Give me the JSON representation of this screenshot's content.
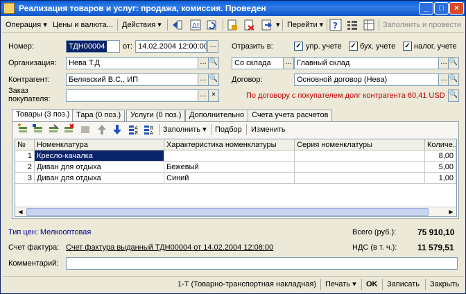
{
  "window": {
    "title": "Реализация товаров и услуг: продажа, комиссия. Проведен",
    "minimize": "_",
    "maximize": "□",
    "close": "×"
  },
  "toolbar": {
    "operation": "Операция",
    "prices": "Цены и валюта...",
    "actions": "Действия",
    "goto": "Перейти",
    "help": "?",
    "fill_and_post": "Заполнить и провести"
  },
  "form": {
    "number_label": "Номер:",
    "number_value": "ТДН00004",
    "from_label": "от:",
    "date_value": "14.02.2004 12:00:00",
    "reflect_label": "Отразить в:",
    "chk_mgmt_label": "упр. учете",
    "chk_acc_label": "бух. учете",
    "chk_tax_label": "налог. учете",
    "org_label": "Организация:",
    "org_value": "Нева Т.Д",
    "warehouse_type_value": "Со склада",
    "warehouse_value": "Главный склад",
    "contractor_label": "Контрагент:",
    "contractor_value": "Белявский В.С., ИП",
    "contract_label": "Договор:",
    "contract_value": "Основной договор (Нева)",
    "order_label_1": "Заказ",
    "order_label_2": "покупателя:",
    "order_value": "",
    "debt_text": "По договору с покупателем долг контрагента 60,41 USD"
  },
  "tabs": [
    {
      "label": "Товары (3 поз.)"
    },
    {
      "label": "Тара (0 поз.)"
    },
    {
      "label": "Услуги (0 поз.)"
    },
    {
      "label": "Дополнительно"
    },
    {
      "label": "Счета учета расчетов"
    }
  ],
  "table_toolbar": {
    "fill": "Заполнить",
    "select": "Подбор",
    "change": "Изменить"
  },
  "table": {
    "columns": [
      "№",
      "Номенклатура",
      "Характеристика номенклатуры",
      "Серия номенклатуры",
      "Количе..."
    ],
    "rows": [
      {
        "n": "1",
        "item": "Кресло-качалка",
        "char": "",
        "series": "",
        "qty": "8,00"
      },
      {
        "n": "2",
        "item": "Диван для отдыха",
        "char": "Бежевый",
        "series": "",
        "qty": "5,00"
      },
      {
        "n": "3",
        "item": "Диван для отдыха",
        "char": "Синий",
        "series": "",
        "qty": "1,00"
      }
    ]
  },
  "summary": {
    "price_type": "Тип цен: Мелкооптовая",
    "total_label": "Всего (руб.):",
    "total_value": "75 910,10",
    "vat_label": "НДС (в т. ч.):",
    "vat_value": "11 579,51",
    "invoice_label": "Счет фактура:",
    "invoice_value": "Счет фактура выданный ТДН00004 от 14.02.2004 12:08:00",
    "comment_label": "Комментарий:",
    "comment_value": ""
  },
  "footer": {
    "ttn": "1-Т (Товарно-транспортная накладная)",
    "print": "Печать",
    "ok": "OK",
    "save": "Записать",
    "close": "Закрыть"
  },
  "colors": {
    "titlebar": "#0A5FD8",
    "debt_text": "#C00000",
    "selection": "#0A246A"
  }
}
